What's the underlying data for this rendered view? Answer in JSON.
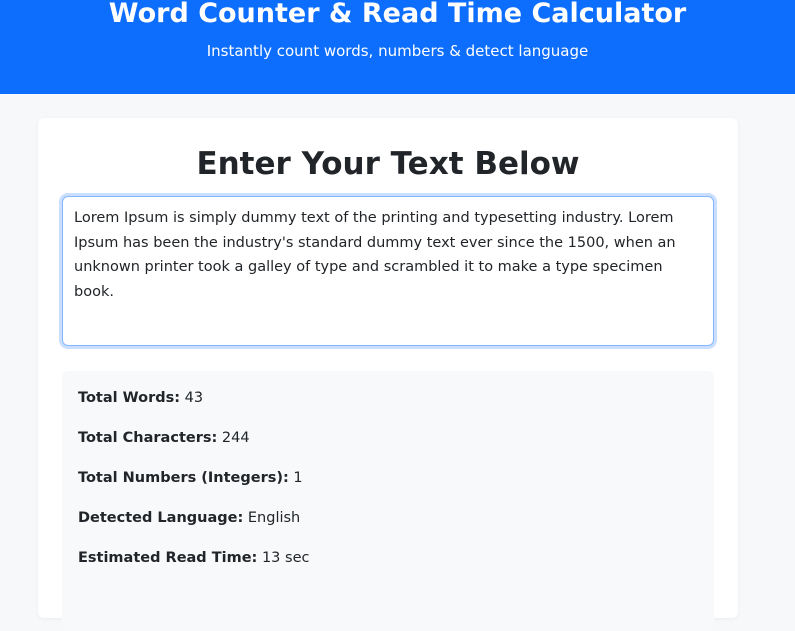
{
  "header": {
    "title": "Word Counter & Read Time Calculator",
    "subtitle": "Instantly count words, numbers & detect language"
  },
  "main": {
    "heading": "Enter Your Text Below",
    "text_value": "Lorem Ipsum is simply dummy text of the printing and typesetting industry. Lorem Ipsum has been the industry's standard dummy text ever since the 1500, when an unknown printer took a galley of type and scrambled it to make a type specimen book."
  },
  "stats": [
    {
      "label": "Total Words:",
      "value": "43"
    },
    {
      "label": "Total Characters:",
      "value": "244"
    },
    {
      "label": "Total Numbers (Integers):",
      "value": "1"
    },
    {
      "label": "Detected Language:",
      "value": "English"
    },
    {
      "label": "Estimated Read Time:",
      "value": "13 sec"
    }
  ],
  "colors": {
    "header_bg": "#0d6efd",
    "page_bg": "#f6f8fa",
    "stats_bg": "#f8f9fa",
    "input_focus": "#86b7fe"
  }
}
